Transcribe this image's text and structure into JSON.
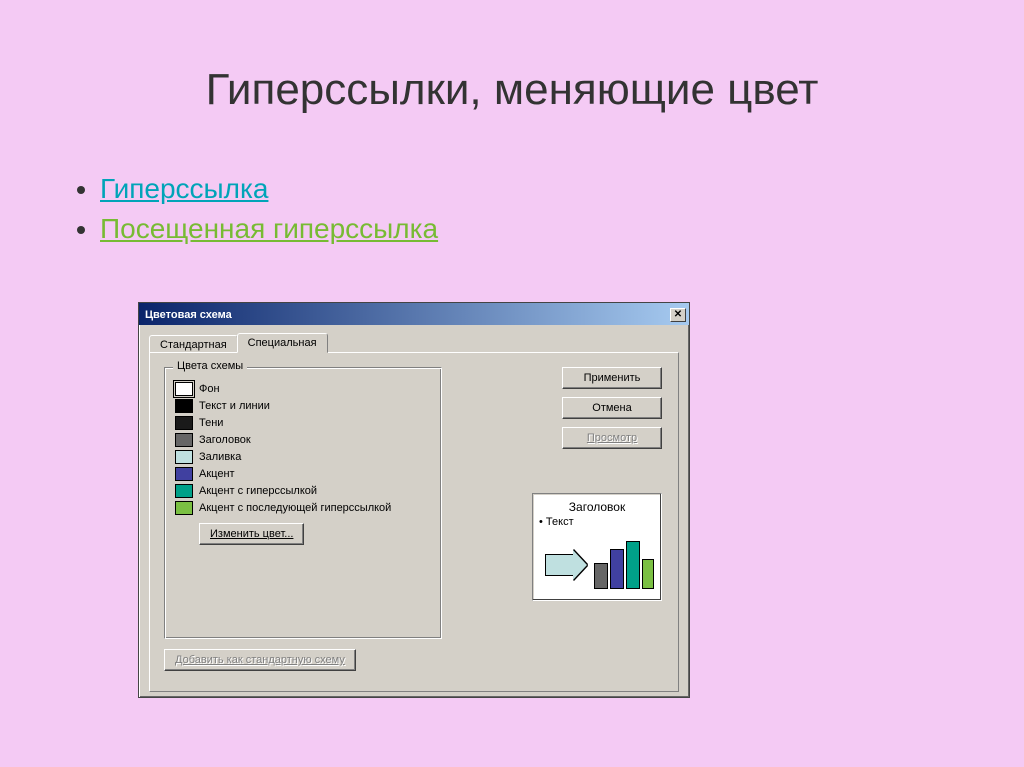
{
  "slide": {
    "title": "Гиперссылки, меняющие цвет",
    "bullet1": "Гиперссылка",
    "bullet2": "Посещенная гиперссылка"
  },
  "dialog": {
    "title": "Цветовая схема",
    "close": "✕",
    "tabs": {
      "standard": "Стандартная",
      "special": "Специальная"
    },
    "group_title": "Цвета схемы",
    "colors": [
      {
        "label": "Фон",
        "hex": "#ffffff"
      },
      {
        "label": "Текст и линии",
        "hex": "#000000"
      },
      {
        "label": "Тени",
        "hex": "#1a1a1a"
      },
      {
        "label": "Заголовок",
        "hex": "#666666"
      },
      {
        "label": "Заливка",
        "hex": "#bfe0e0"
      },
      {
        "label": "Акцент",
        "hex": "#4040a0"
      },
      {
        "label": "Акцент с гиперссылкой",
        "hex": "#00a088"
      },
      {
        "label": "Акцент с последующей гиперссылкой",
        "hex": "#7bc043"
      }
    ],
    "change_color": "Изменить цвет...",
    "add_scheme": "Добавить как стандартную схему",
    "buttons": {
      "apply": "Применить",
      "cancel": "Отмена",
      "preview": "Просмотр"
    },
    "preview": {
      "title": "Заголовок",
      "text": "Текст"
    }
  }
}
